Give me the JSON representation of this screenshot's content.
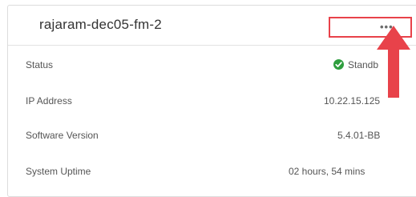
{
  "card": {
    "title": "rajaram-dec05-fm-2",
    "more_icon": "more-horizontal-icon",
    "more_label": "•••"
  },
  "details": [
    {
      "label": "Status",
      "value": "Standb",
      "icon": "check-circle-icon"
    },
    {
      "label": "IP Address",
      "value": "10.22.15.125"
    },
    {
      "label": "Software Version",
      "value": "5.4.01-BB"
    },
    {
      "label": "System Uptime",
      "value": "02 hours, 54 mins"
    }
  ],
  "colors": {
    "highlight_box": "#e8424a",
    "arrow": "#e8424a",
    "status_ok": "#2e9e3e"
  },
  "annotation": {
    "arrow_icon": "pointer-arrow-icon"
  }
}
